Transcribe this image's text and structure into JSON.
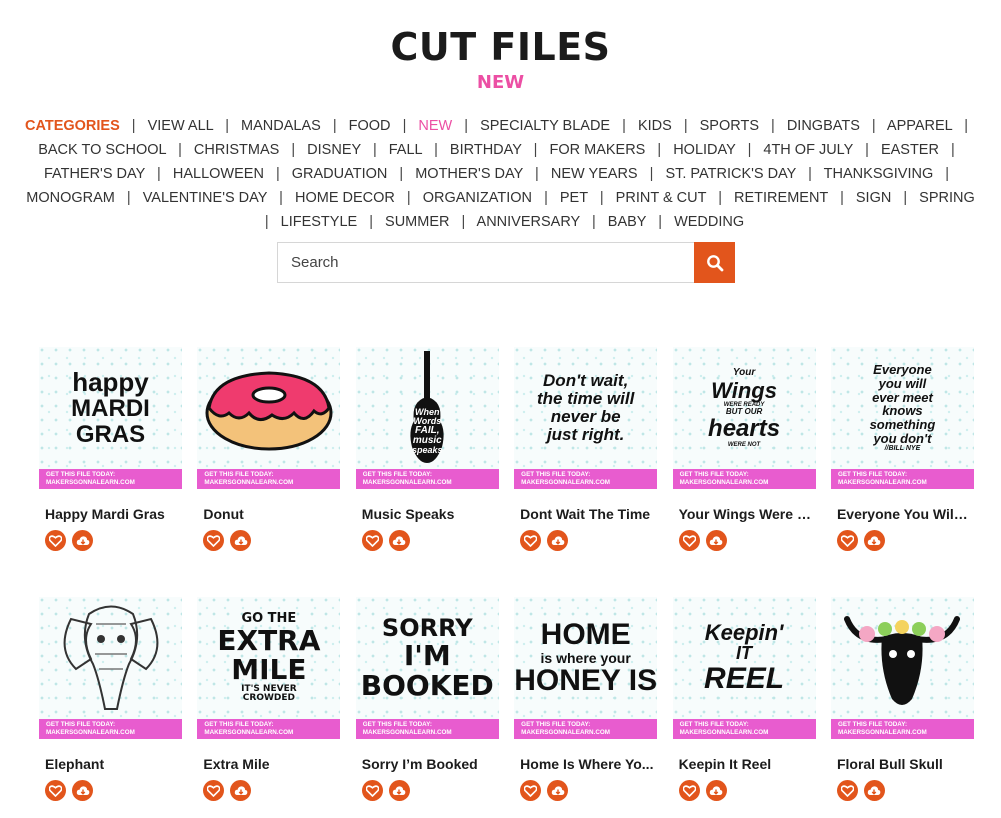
{
  "header": {
    "title": "CUT FILES",
    "subtitle": "NEW"
  },
  "categories": {
    "heading": "CATEGORIES",
    "active": "NEW",
    "items": [
      "VIEW ALL",
      "MANDALAS",
      "FOOD",
      "NEW",
      "SPECIALTY BLADE",
      "KIDS",
      "SPORTS",
      "DINGBATS",
      "APPAREL",
      "BACK TO SCHOOL",
      "CHRISTMAS",
      "DISNEY",
      "FALL",
      "BIRTHDAY",
      "FOR MAKERS",
      "HOLIDAY",
      "4TH OF JULY",
      "EASTER",
      "FATHER'S DAY",
      "HALLOWEEN",
      "GRADUATION",
      "MOTHER'S DAY",
      "NEW YEARS",
      "ST. PATRICK'S DAY",
      "THANKSGIVING",
      "MONOGRAM",
      "VALENTINE'S DAY",
      "HOME DECOR",
      "ORGANIZATION",
      "PET",
      "PRINT & CUT",
      "RETIREMENT",
      "SIGN",
      "SPRING",
      "LIFESTYLE",
      "SUMMER",
      "ANNIVERSARY",
      "BABY",
      "WEDDING"
    ]
  },
  "search": {
    "placeholder": "Search",
    "icon": "search-icon"
  },
  "banner_text": {
    "line1": "GET THIS FILE TODAY:",
    "line2": "MAKERSGONNALEARN.COM"
  },
  "products": [
    {
      "title": "Happy Mardi Gras",
      "art": [
        "happy",
        "MARDI",
        "GRAS"
      ]
    },
    {
      "title": "Donut",
      "art": []
    },
    {
      "title": "Music Speaks",
      "art": [
        "When",
        "Words",
        "FAIL,",
        "music",
        "speaks"
      ]
    },
    {
      "title": "Dont Wait The Time",
      "art": [
        "Don't wait,",
        "the time will",
        "never be",
        "just right."
      ]
    },
    {
      "title": "Your Wings Were R...",
      "art": [
        "Your",
        "Wings",
        "WERE READY",
        "BUT OUR",
        "hearts",
        "WERE NOT"
      ]
    },
    {
      "title": "Everyone You Will ...",
      "art": [
        "Everyone",
        "you will",
        "ever meet",
        "knows",
        "something",
        "you don't",
        "//BILL NYE"
      ]
    },
    {
      "title": "Elephant",
      "art": []
    },
    {
      "title": "Extra Mile",
      "art": [
        "GO THE",
        "EXTRA",
        "MILE",
        "IT'S NEVER",
        "CROWDED"
      ]
    },
    {
      "title": "Sorry I’m Booked",
      "art": [
        "SORRY",
        "I'M BOOKED"
      ]
    },
    {
      "title": "Home Is Where Yo...",
      "art": [
        "HOME",
        "is where your",
        "HONEY IS"
      ]
    },
    {
      "title": "Keepin It Reel",
      "art": [
        "Keepin'",
        "IT",
        "REEL"
      ]
    },
    {
      "title": "Floral Bull Skull",
      "art": []
    }
  ],
  "colors": {
    "accent": "#e2551c",
    "pink": "#ec4fa4",
    "banner": "#e85ccf"
  },
  "action_icons": [
    "heart-icon",
    "download-icon"
  ]
}
